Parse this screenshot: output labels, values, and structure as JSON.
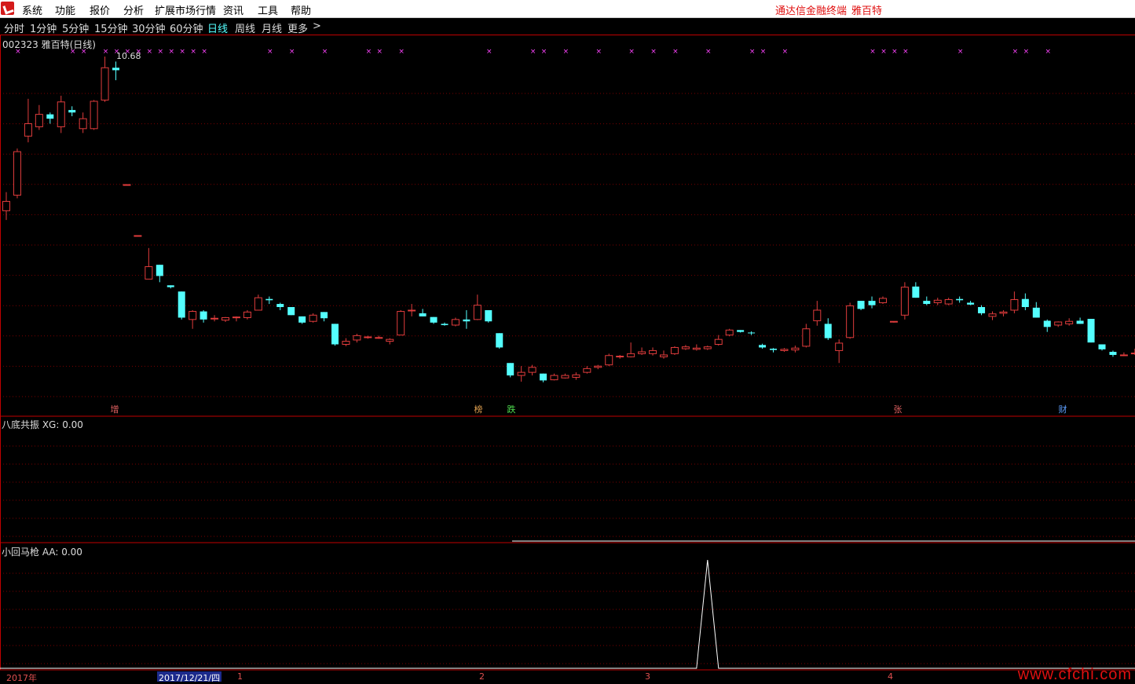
{
  "menu": {
    "items": [
      "系统",
      "功能",
      "报价",
      "分析",
      "扩展市场行情",
      "资讯",
      "工具",
      "帮助"
    ],
    "right": [
      "通达信金融终端",
      "雅百特"
    ]
  },
  "periods": {
    "items": [
      "分时",
      "1分钟",
      "5分钟",
      "15分钟",
      "30分钟",
      "60分钟",
      "日线",
      "周线",
      "月线",
      "更多"
    ],
    "active": "日线",
    "more_arrow": ">"
  },
  "main_panel": {
    "title": "002323 雅百特(日线)",
    "peak_label": "10.68",
    "markers": [
      {
        "text": "增",
        "color": "#e06060"
      },
      {
        "text": "榜",
        "color": "#e0a050"
      },
      {
        "text": "跌",
        "color": "#50e050"
      },
      {
        "text": "张",
        "color": "#e06060"
      },
      {
        "text": "财",
        "color": "#5fa0ff"
      }
    ]
  },
  "indicator1": {
    "title": "八底共振 XG: 0.00"
  },
  "indicator2": {
    "title": "小回马枪 AA: 0.00"
  },
  "time_axis": {
    "year": "2017年",
    "cursor_date": "2017/12/21/四",
    "months": [
      "1",
      "2",
      "3",
      "4"
    ]
  },
  "watermark": "www.cfchi.com",
  "colors": {
    "up": "#e03c3c",
    "down": "#54ffff",
    "grid": "#7a0000",
    "signal": "#ff44ff"
  },
  "chart_data": {
    "type": "candlestick",
    "note_series": "daily OHLC, price units",
    "ohlc": [
      [
        8.2,
        8.5,
        8.05,
        8.35
      ],
      [
        8.45,
        9.2,
        8.4,
        9.15
      ],
      [
        9.4,
        10.0,
        9.3,
        9.6
      ],
      [
        9.55,
        9.9,
        9.5,
        9.75
      ],
      [
        9.75,
        9.78,
        9.6,
        9.68
      ],
      [
        9.55,
        10.05,
        9.45,
        9.95
      ],
      [
        9.82,
        9.88,
        9.72,
        9.78
      ],
      [
        9.52,
        9.78,
        9.45,
        9.68
      ],
      [
        9.52,
        9.98,
        9.5,
        9.96
      ],
      [
        9.98,
        10.68,
        9.95,
        10.5
      ],
      [
        10.5,
        10.6,
        10.3,
        10.46
      ],
      [
        8.62,
        8.62,
        8.62,
        8.62
      ],
      [
        7.8,
        7.8,
        7.8,
        7.8
      ],
      [
        7.1,
        7.6,
        7.1,
        7.3
      ],
      [
        7.33,
        7.33,
        7.05,
        7.15
      ],
      [
        7.0,
        7.0,
        6.95,
        6.97
      ],
      [
        6.9,
        6.9,
        6.45,
        6.48
      ],
      [
        6.45,
        6.6,
        6.3,
        6.58
      ],
      [
        6.58,
        6.6,
        6.4,
        6.45
      ],
      [
        6.47,
        6.52,
        6.42,
        6.47
      ],
      [
        6.44,
        6.49,
        6.41,
        6.48
      ],
      [
        6.48,
        6.5,
        6.42,
        6.49
      ],
      [
        6.48,
        6.6,
        6.45,
        6.57
      ],
      [
        6.6,
        6.85,
        6.6,
        6.8
      ],
      [
        6.78,
        6.82,
        6.7,
        6.76
      ],
      [
        6.7,
        6.72,
        6.6,
        6.65
      ],
      [
        6.65,
        6.65,
        6.52,
        6.52
      ],
      [
        6.5,
        6.5,
        6.38,
        6.4
      ],
      [
        6.42,
        6.55,
        6.4,
        6.52
      ],
      [
        6.57,
        6.57,
        6.42,
        6.47
      ],
      [
        6.38,
        6.38,
        6.03,
        6.05
      ],
      [
        6.05,
        6.15,
        6.02,
        6.1
      ],
      [
        6.12,
        6.22,
        6.08,
        6.19
      ],
      [
        6.16,
        6.19,
        6.14,
        6.17
      ],
      [
        6.16,
        6.19,
        6.14,
        6.16
      ],
      [
        6.1,
        6.15,
        6.05,
        6.13
      ],
      [
        6.2,
        6.6,
        6.2,
        6.58
      ],
      [
        6.6,
        6.7,
        6.5,
        6.6
      ],
      [
        6.55,
        6.62,
        6.5,
        6.5
      ],
      [
        6.49,
        6.49,
        6.38,
        6.4
      ],
      [
        6.38,
        6.4,
        6.35,
        6.36
      ],
      [
        6.36,
        6.48,
        6.34,
        6.45
      ],
      [
        6.45,
        6.6,
        6.3,
        6.42
      ],
      [
        6.45,
        6.85,
        6.44,
        6.68
      ],
      [
        6.6,
        6.6,
        6.4,
        6.42
      ],
      [
        6.23,
        6.23,
        5.98,
        6.0
      ],
      [
        5.75,
        5.75,
        5.52,
        5.55
      ],
      [
        5.55,
        5.7,
        5.45,
        5.6
      ],
      [
        5.6,
        5.72,
        5.55,
        5.68
      ],
      [
        5.58,
        5.58,
        5.44,
        5.47
      ],
      [
        5.48,
        5.58,
        5.47,
        5.55
      ],
      [
        5.51,
        5.58,
        5.5,
        5.55
      ],
      [
        5.52,
        5.6,
        5.48,
        5.56
      ],
      [
        5.6,
        5.7,
        5.58,
        5.66
      ],
      [
        5.68,
        5.72,
        5.65,
        5.7
      ],
      [
        5.72,
        5.9,
        5.7,
        5.87
      ],
      [
        5.86,
        5.88,
        5.82,
        5.86
      ],
      [
        5.85,
        6.08,
        5.84,
        5.9
      ],
      [
        5.9,
        6.0,
        5.88,
        5.93
      ],
      [
        5.9,
        6.0,
        5.87,
        5.95
      ],
      [
        5.85,
        5.95,
        5.82,
        5.88
      ],
      [
        5.9,
        6.02,
        5.88,
        6.0
      ],
      [
        5.98,
        6.04,
        5.96,
        6.01
      ],
      [
        5.97,
        6.05,
        5.95,
        5.99
      ],
      [
        5.98,
        6.03,
        5.96,
        6.01
      ],
      [
        6.05,
        6.2,
        6.03,
        6.13
      ],
      [
        6.2,
        6.3,
        6.18,
        6.28
      ],
      [
        6.28,
        6.28,
        6.24,
        6.25
      ],
      [
        6.24,
        6.26,
        6.2,
        6.23
      ],
      [
        6.04,
        6.06,
        5.98,
        6.0
      ],
      [
        5.98,
        5.99,
        5.92,
        5.96
      ],
      [
        5.95,
        5.99,
        5.93,
        5.97
      ],
      [
        5.96,
        6.03,
        5.92,
        5.99
      ],
      [
        6.02,
        6.38,
        6.0,
        6.3
      ],
      [
        6.43,
        6.75,
        6.35,
        6.6
      ],
      [
        6.38,
        6.47,
        6.12,
        6.15
      ],
      [
        5.95,
        6.13,
        5.75,
        6.07
      ],
      [
        6.16,
        6.72,
        6.14,
        6.67
      ],
      [
        6.75,
        6.75,
        6.6,
        6.62
      ],
      [
        6.75,
        6.82,
        6.63,
        6.68
      ],
      [
        6.72,
        6.82,
        6.7,
        6.79
      ],
      [
        6.42,
        6.4,
        6.42,
        6.42
      ],
      [
        6.52,
        7.05,
        6.45,
        6.97
      ],
      [
        6.98,
        7.05,
        6.8,
        6.8
      ],
      [
        6.75,
        6.82,
        6.68,
        6.7
      ],
      [
        6.72,
        6.8,
        6.68,
        6.76
      ],
      [
        6.7,
        6.8,
        6.68,
        6.77
      ],
      [
        6.78,
        6.82,
        6.72,
        6.76
      ],
      [
        6.72,
        6.75,
        6.68,
        6.69
      ],
      [
        6.65,
        6.68,
        6.52,
        6.55
      ],
      [
        6.5,
        6.58,
        6.44,
        6.54
      ],
      [
        6.55,
        6.6,
        6.5,
        6.57
      ],
      [
        6.6,
        6.9,
        6.55,
        6.77
      ],
      [
        6.78,
        6.87,
        6.6,
        6.65
      ],
      [
        6.64,
        6.73,
        6.48,
        6.48
      ],
      [
        6.43,
        6.45,
        6.25,
        6.33
      ],
      [
        6.36,
        6.42,
        6.33,
        6.41
      ],
      [
        6.38,
        6.47,
        6.35,
        6.42
      ],
      [
        6.43,
        6.48,
        6.38,
        6.38
      ],
      [
        6.46,
        6.46,
        6.08,
        6.08
      ],
      [
        6.05,
        6.05,
        5.95,
        5.97
      ],
      [
        5.93,
        5.95,
        5.85,
        5.88
      ],
      [
        5.87,
        5.92,
        5.86,
        5.88
      ],
      [
        5.9,
        5.98,
        5.88,
        5.91
      ],
      [
        5.95,
        6.03,
        5.88,
        6.0
      ],
      [
        5.98,
        6.04,
        5.96,
        6.03
      ]
    ],
    "signal_top_days": [
      1,
      6,
      7,
      9,
      10,
      11,
      12,
      13,
      14,
      15,
      16,
      17,
      18,
      24,
      26,
      29,
      33,
      34,
      36,
      44,
      48,
      49,
      51,
      54,
      57,
      59,
      61,
      64,
      68,
      69,
      71,
      79,
      80,
      81,
      82,
      87,
      92,
      93,
      95
    ],
    "ind2_spike_day": 64
  }
}
